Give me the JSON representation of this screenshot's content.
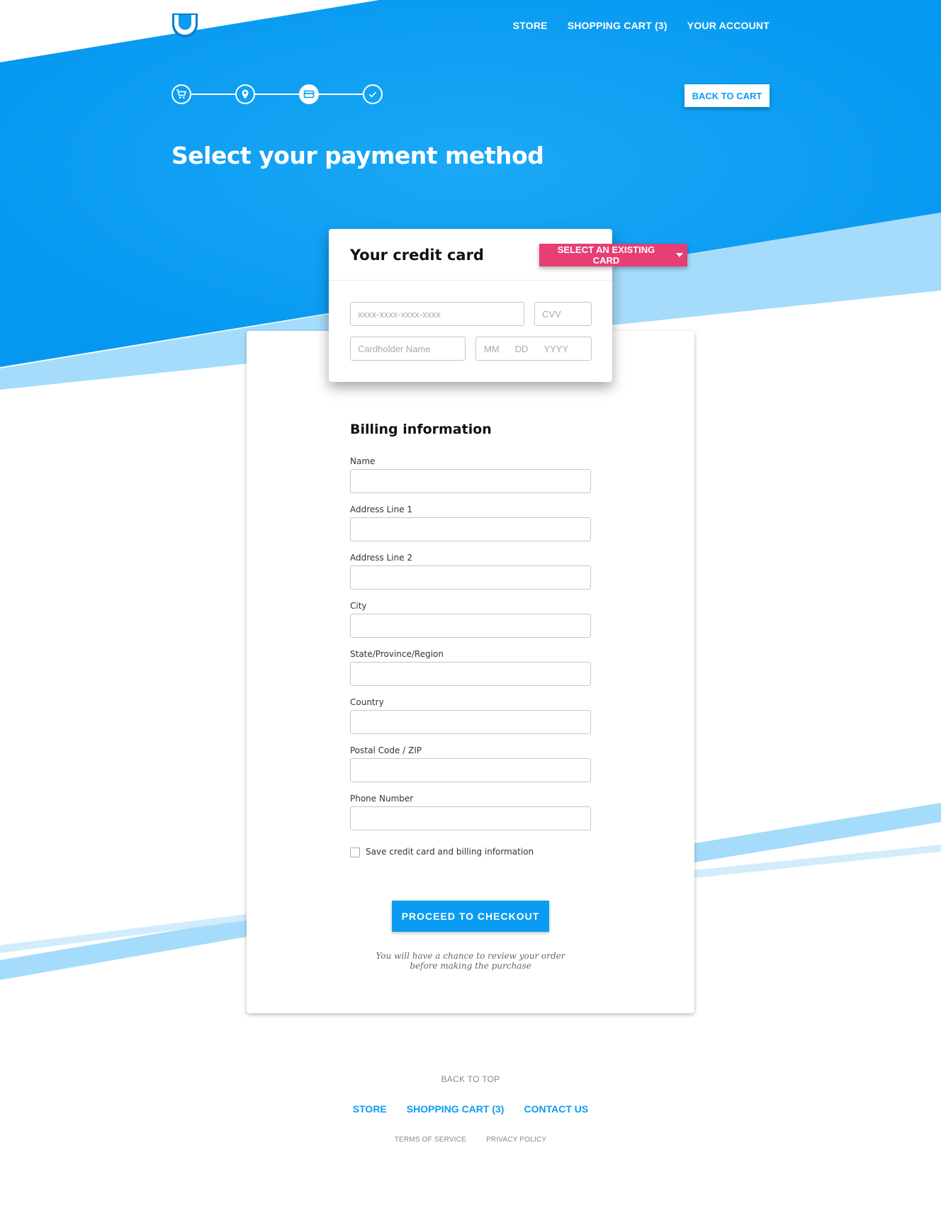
{
  "header": {
    "logo": "u-shield-logo",
    "nav": [
      {
        "label": "STORE"
      },
      {
        "label": "SHOPPING CART (3)"
      },
      {
        "label": "YOUR ACCOUNT"
      }
    ]
  },
  "stepper": {
    "steps": [
      {
        "icon": "cart-icon",
        "state": "complete"
      },
      {
        "icon": "location-pin-icon",
        "state": "complete"
      },
      {
        "icon": "credit-card-icon",
        "state": "active"
      },
      {
        "icon": "checkmark-icon",
        "state": "pending"
      }
    ]
  },
  "back_to_cart": "BACK TO CART",
  "page_title": "Select your payment method",
  "credit_card": {
    "title": "Your credit card",
    "select_existing": "SELECT AN EXISTING CARD",
    "number_placeholder": "xxxx-xxxx-xxxx-xxxx",
    "cvv_placeholder": "CVV",
    "name_placeholder": "Cardholder Name",
    "date_parts": [
      "MM",
      "DD",
      "YYYY"
    ]
  },
  "billing": {
    "title": "Billing information",
    "fields": [
      {
        "label": "Name",
        "value": ""
      },
      {
        "label": "Address Line 1",
        "value": ""
      },
      {
        "label": "Address Line 2",
        "value": ""
      },
      {
        "label": "City",
        "value": ""
      },
      {
        "label": "State/Province/Region",
        "value": ""
      },
      {
        "label": "Country",
        "value": ""
      },
      {
        "label": "Postal Code / ZIP",
        "value": ""
      },
      {
        "label": "Phone Number",
        "value": ""
      }
    ],
    "save_label": "Save credit card and billing information",
    "save_checked": false,
    "proceed_label": "PROCEED TO CHECKOUT",
    "review_note": "You will have a chance to review your order before making the purchase"
  },
  "footer": {
    "back_to_top": "BACK TO TOP",
    "nav": [
      {
        "label": "STORE"
      },
      {
        "label": "SHOPPING CART (3)"
      },
      {
        "label": "CONTACT US"
      }
    ],
    "legal": [
      {
        "label": "TERMS OF SERVICE"
      },
      {
        "label": "PRIVACY POLICY"
      }
    ]
  },
  "colors": {
    "primary_blue": "#0a9cf2",
    "light_blue": "#a6dcfb",
    "pink_accent": "#e63f74"
  }
}
